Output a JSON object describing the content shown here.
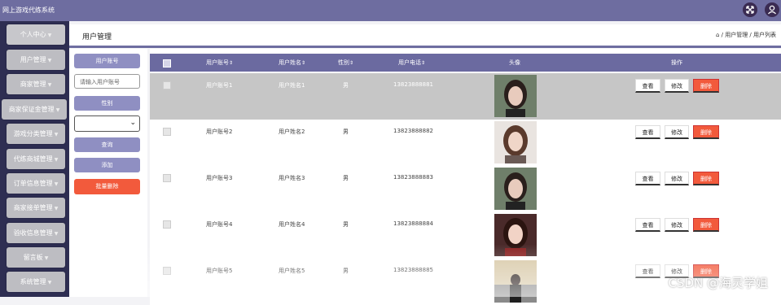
{
  "app": {
    "title": "网上游戏代练系统"
  },
  "topbar_icons": [
    "fullscreen-icon",
    "user-icon"
  ],
  "sidebar": {
    "items": [
      {
        "label": "个人中心"
      },
      {
        "label": "用户管理"
      },
      {
        "label": "商家管理"
      },
      {
        "label": "商家保证金管理"
      },
      {
        "label": "游戏分类管理"
      },
      {
        "label": "代练商城管理"
      },
      {
        "label": "订单信息管理"
      },
      {
        "label": "商家接单管理"
      },
      {
        "label": "验收信息管理"
      },
      {
        "label": "留言板"
      },
      {
        "label": "系统管理"
      }
    ]
  },
  "header": {
    "title": "用户管理",
    "breadcrumb": "⌂ / 用户管理 / 用户列表"
  },
  "search": {
    "account_label": "用户账号",
    "account_placeholder": "请输入用户账号",
    "gender_label": "性别",
    "gender_value": "",
    "query_button": "查询",
    "add_button": "添加",
    "batch_delete_button": "批量删除"
  },
  "table": {
    "columns": [
      "用户账号",
      "用户姓名",
      "性别",
      "用户电话",
      "头像",
      "操作"
    ],
    "rows": [
      {
        "account": "用户账号1",
        "name": "用户姓名1",
        "gender": "男",
        "phone": "13823888881"
      },
      {
        "account": "用户账号2",
        "name": "用户姓名2",
        "gender": "男",
        "phone": "13823888882"
      },
      {
        "account": "用户账号3",
        "name": "用户姓名3",
        "gender": "男",
        "phone": "13823888883"
      },
      {
        "account": "用户账号4",
        "name": "用户姓名4",
        "gender": "男",
        "phone": "13823888884"
      },
      {
        "account": "用户账号5",
        "name": "用户姓名5",
        "gender": "男",
        "phone": "13823888885"
      }
    ],
    "actions": {
      "view": "查看",
      "edit": "修改",
      "delete": "删除"
    }
  },
  "watermark": "CSDN @海灵学姐",
  "colors": {
    "primary": "#6e6da0",
    "sidebar_bg": "#2e2e52",
    "danger": "#f25a3c"
  }
}
